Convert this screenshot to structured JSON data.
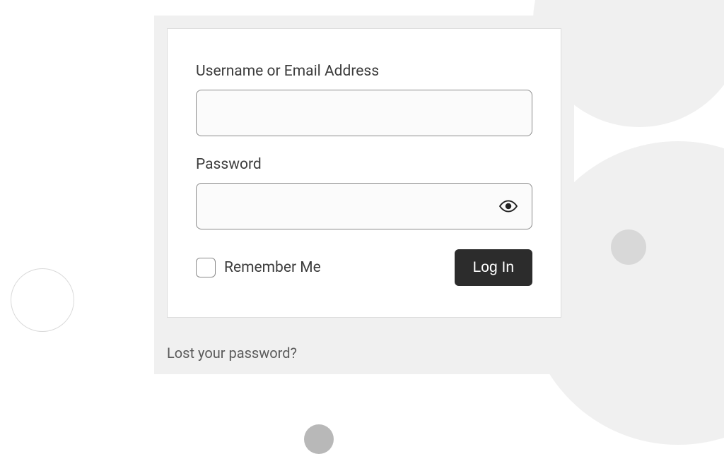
{
  "form": {
    "username_label": "Username or Email Address",
    "username_value": "",
    "password_label": "Password",
    "password_value": "",
    "remember_label": "Remember Me",
    "submit_label": "Log In"
  },
  "links": {
    "lost_password": "Lost your password?"
  }
}
